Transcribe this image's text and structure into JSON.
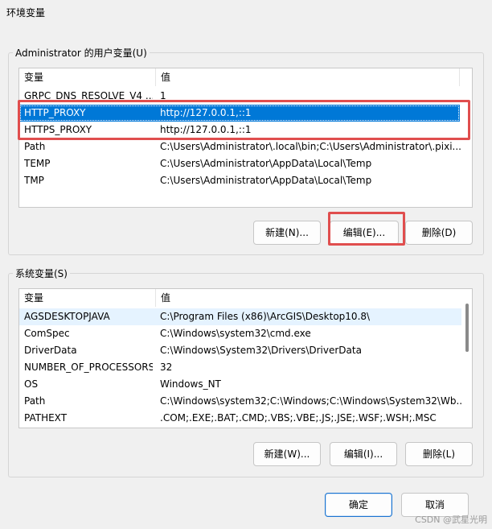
{
  "window": {
    "title": "环境变量"
  },
  "user_vars": {
    "group_label": "Administrator 的用户变量(U)",
    "columns": [
      "变量",
      "值"
    ],
    "rows": [
      {
        "name": "GRPC_DNS_RESOLVE_V4 ...",
        "value": "1"
      },
      {
        "name": "HTTP_PROXY",
        "value": "http://127.0.0.1,::1"
      },
      {
        "name": "HTTPS_PROXY",
        "value": "http://127.0.0.1,::1"
      },
      {
        "name": "Path",
        "value": "C:\\Users\\Administrator\\.local\\bin;C:\\Users\\Administrator\\.pixi..."
      },
      {
        "name": "TEMP",
        "value": "C:\\Users\\Administrator\\AppData\\Local\\Temp"
      },
      {
        "name": "TMP",
        "value": "C:\\Users\\Administrator\\AppData\\Local\\Temp"
      }
    ],
    "buttons": {
      "new": "新建(N)...",
      "edit": "编辑(E)...",
      "delete": "删除(D)"
    }
  },
  "system_vars": {
    "group_label": "系统变量(S)",
    "columns": [
      "变量",
      "值"
    ],
    "rows": [
      {
        "name": "AGSDESKTOPJAVA",
        "value": "C:\\Program Files (x86)\\ArcGIS\\Desktop10.8\\"
      },
      {
        "name": "ComSpec",
        "value": "C:\\Windows\\system32\\cmd.exe"
      },
      {
        "name": "DriverData",
        "value": "C:\\Windows\\System32\\Drivers\\DriverData"
      },
      {
        "name": "NUMBER_OF_PROCESSORS",
        "value": "32"
      },
      {
        "name": "OS",
        "value": "Windows_NT"
      },
      {
        "name": "Path",
        "value": "C:\\Windows\\system32;C:\\Windows;C:\\Windows\\System32\\Wb..."
      },
      {
        "name": "PATHEXT",
        "value": ".COM;.EXE;.BAT;.CMD;.VBS;.VBE;.JS;.JSE;.WSF;.WSH;.MSC"
      }
    ],
    "buttons": {
      "new": "新建(W)...",
      "edit": "编辑(I)...",
      "delete": "删除(L)"
    }
  },
  "footer": {
    "ok": "确定",
    "cancel": "取消"
  },
  "watermark": "CSDN @武星光明",
  "colors": {
    "selection": "#0078d7",
    "annotation": "#e04e4e"
  }
}
